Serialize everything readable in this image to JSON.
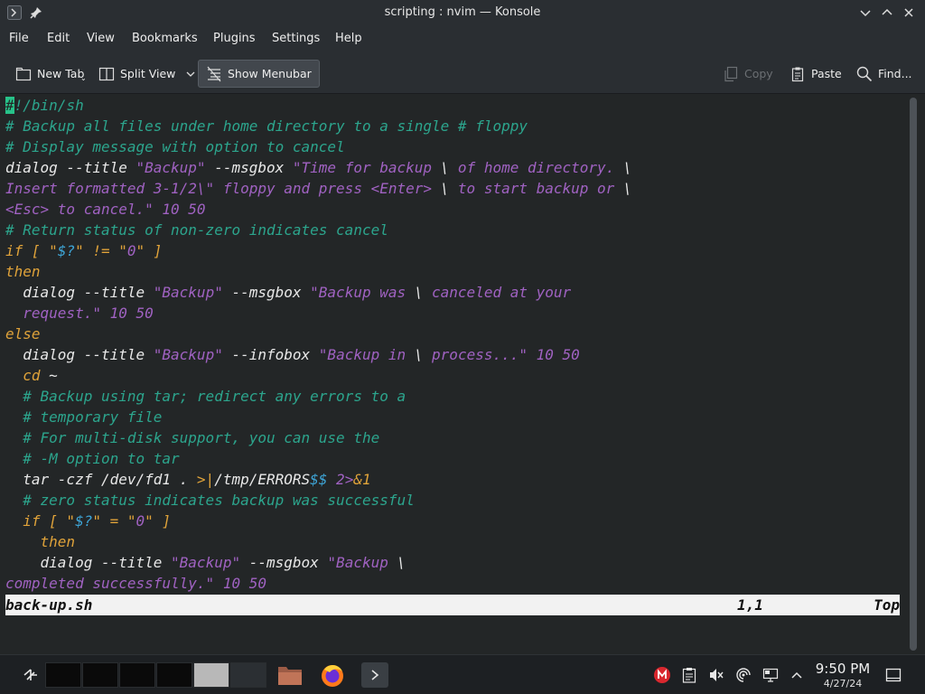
{
  "window": {
    "title": "scripting : nvim — Konsole"
  },
  "menubar": {
    "items": [
      "File",
      "Edit",
      "View",
      "Bookmarks",
      "Plugins",
      "Settings",
      "Help"
    ]
  },
  "toolbar": {
    "new_tab": "New Tab",
    "split_view": "Split View",
    "show_menubar": "Show Menubar",
    "copy": "Copy",
    "paste": "Paste",
    "find": "Find..."
  },
  "editor": {
    "lines": [
      [
        [
          "#",
          "cursor"
        ],
        [
          "!/bin/sh",
          "c-comment"
        ]
      ],
      [
        [
          "# Backup all files under home directory to a single # floppy",
          "c-comment"
        ]
      ],
      [
        [
          "# Display message with option to cancel",
          "c-comment"
        ]
      ],
      [
        [
          "dialog --title ",
          "c-plain"
        ],
        [
          "\"Backup\"",
          "c-str"
        ],
        [
          " --msgbox ",
          "c-plain"
        ],
        [
          "\"Time for backup ",
          "c-str"
        ],
        [
          "\\",
          "c-plain"
        ],
        [
          " of home directory. ",
          "c-str"
        ],
        [
          "\\",
          "c-plain"
        ]
      ],
      [
        [
          "Insert formatted 3-1/2\\\" floppy and press <Enter> ",
          "c-str"
        ],
        [
          "\\",
          "c-plain"
        ],
        [
          " to start backup or ",
          "c-str"
        ],
        [
          "\\",
          "c-plain"
        ]
      ],
      [
        [
          "<Esc> to cancel.\" 10 50",
          "c-str"
        ]
      ],
      [
        [
          "# Return status of non-zero indicates cancel",
          "c-comment"
        ]
      ],
      [
        [
          "if",
          "c-kw"
        ],
        [
          " [ \"",
          "c-kw"
        ],
        [
          "$?",
          "c-var"
        ],
        [
          "\" != \"",
          "c-kw"
        ],
        [
          "0",
          "c-str"
        ],
        [
          "\" ]",
          "c-kw"
        ]
      ],
      [
        [
          "then",
          "c-kw"
        ]
      ],
      [
        [
          "  dialog --title ",
          "c-plain"
        ],
        [
          "\"Backup\"",
          "c-str"
        ],
        [
          " --msgbox ",
          "c-plain"
        ],
        [
          "\"Backup was ",
          "c-str"
        ],
        [
          "\\",
          "c-plain"
        ],
        [
          " canceled at your",
          "c-str"
        ]
      ],
      [
        [
          "  request.\" 10 50",
          "c-str"
        ]
      ],
      [
        [
          "else",
          "c-kw"
        ]
      ],
      [
        [
          "  dialog --title ",
          "c-plain"
        ],
        [
          "\"Backup\"",
          "c-str"
        ],
        [
          " --infobox ",
          "c-plain"
        ],
        [
          "\"Backup in ",
          "c-str"
        ],
        [
          "\\",
          "c-plain"
        ],
        [
          " process...\" 10 50",
          "c-str"
        ]
      ],
      [
        [
          "  cd",
          "c-kw"
        ],
        [
          " ~",
          "c-plain"
        ]
      ],
      [
        [
          "  # Backup using tar; redirect any errors to a",
          "c-comment"
        ]
      ],
      [
        [
          "  # temporary file",
          "c-comment"
        ]
      ],
      [
        [
          "  # For multi-disk support, you can use the",
          "c-comment"
        ]
      ],
      [
        [
          "  # -M option to tar",
          "c-comment"
        ]
      ],
      [
        [
          "  tar -czf /dev/fd1 . ",
          "c-plain"
        ],
        [
          ">|",
          "c-kw"
        ],
        [
          "/tmp/ERRORS",
          "c-plain"
        ],
        [
          "$$",
          "c-var"
        ],
        [
          " 2>",
          "c-str"
        ],
        [
          "&1",
          "c-kw"
        ]
      ],
      [
        [
          "  # zero status indicates backup was successful",
          "c-comment"
        ]
      ],
      [
        [
          "  if",
          "c-kw"
        ],
        [
          " [ \"",
          "c-kw"
        ],
        [
          "$?",
          "c-var"
        ],
        [
          "\" = \"",
          "c-kw"
        ],
        [
          "0",
          "c-str"
        ],
        [
          "\" ]",
          "c-kw"
        ]
      ],
      [
        [
          "    then",
          "c-kw"
        ]
      ],
      [
        [
          "    dialog --title ",
          "c-plain"
        ],
        [
          "\"Backup\"",
          "c-str"
        ],
        [
          " --msgbox ",
          "c-plain"
        ],
        [
          "\"Backup ",
          "c-str"
        ],
        [
          "\\",
          "c-plain"
        ]
      ],
      [
        [
          "completed successfully.\" 10 50",
          "c-str"
        ]
      ]
    ]
  },
  "statusline": {
    "filename": "back-up.sh",
    "position": "1,1",
    "scroll": "Top"
  },
  "taskbar": {
    "time": "9:50 PM",
    "date": "4/27/24"
  },
  "colors": {
    "comment": "#2ca58d",
    "string": "#a062c2",
    "keyword": "#e0a33a",
    "variable": "#3ea6d8",
    "cursor": "#27c289"
  },
  "icons": {
    "titlebar": [
      "terminal-icon",
      "pin-icon",
      "minimize-icon",
      "maximize-icon",
      "close-icon"
    ],
    "tray": [
      "mega-icon",
      "clipboard-icon",
      "volume-muted-icon",
      "network-icon",
      "display-icon",
      "tray-expand-icon",
      "show-desktop-icon"
    ]
  }
}
